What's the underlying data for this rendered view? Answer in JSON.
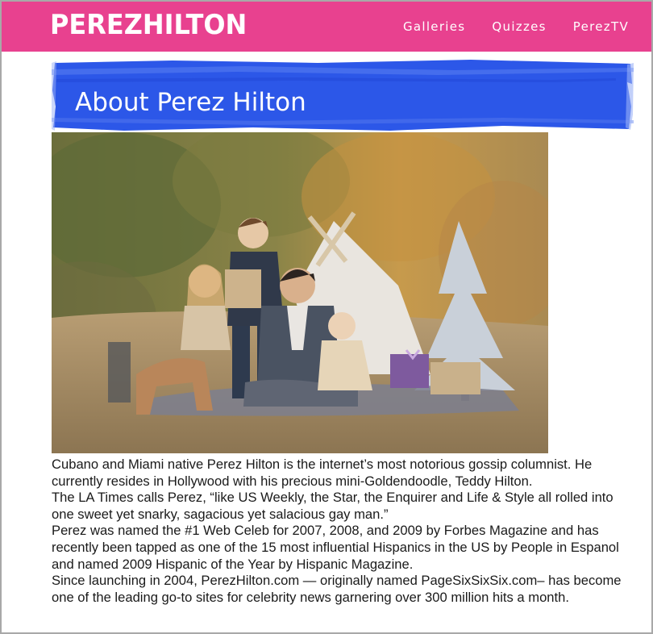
{
  "header": {
    "logo": "PEREZHILTON",
    "brand_color": "#e8418f",
    "nav": [
      "Galleries",
      "Quizzes",
      "PerezTV"
    ]
  },
  "banner": {
    "title": "About Perez Hilton",
    "color": "#2c57e8"
  },
  "photo": {
    "icon": "family-portrait-photo"
  },
  "content": {
    "paragraphs": [
      "Cubano and Miami native Perez Hilton is the internet’s most notorious gossip columnist. He currently resides in Hollywood with his precious mini-Goldendoodle, Teddy Hilton.",
      "The LA Times calls Perez, “like US Weekly, the Star, the Enquirer and Life & Style all rolled into one sweet yet snarky, sagacious yet salacious gay man.”",
      "Perez was named the #1 Web Celeb for 2007, 2008, and 2009 by Forbes Magazine and has recently been tapped as one of the 15 most influential Hispanics in the US by People in Espanol and named 2009 Hispanic of the Year by Hispanic Magazine.",
      "Since launching in 2004, PerezHilton.com — originally named PageSixSixSix.com– has become one of the leading go-to sites for celebrity news garnering over 300 million hits a month."
    ]
  }
}
